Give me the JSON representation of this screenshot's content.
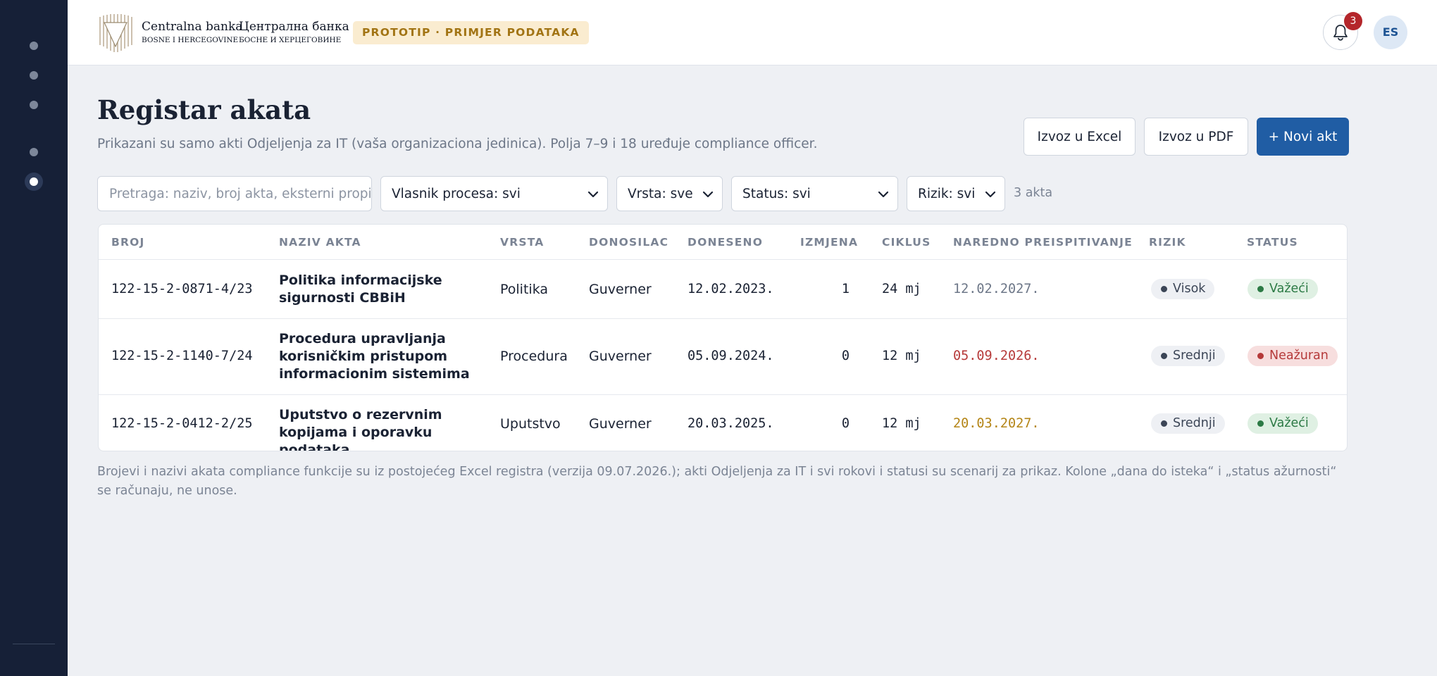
{
  "header": {
    "logo_latin_name": "Centralna banka",
    "logo_latin_sub": "BOSNE I HERCEGOVINE",
    "logo_cyrillic_name": "Централна банка",
    "logo_cyrillic_sub": "БОСНЕ И ХЕРЦЕГОВИНЕ",
    "prototype_badge": "PROTOTIP · PRIMJER PODATAKA",
    "notification_count": "3",
    "user_initials": "ES"
  },
  "page": {
    "title": "Registar akata",
    "subtitle": "Prikazani su samo akti Odjeljenja za IT (vaša organizaciona jedinica). Polja 7–9 i 18 uređuje compliance officer."
  },
  "actions": {
    "export_excel": "Izvoz u Excel",
    "export_pdf": "Izvoz u PDF",
    "new_act": "+ Novi akt"
  },
  "filters": {
    "search_placeholder": "Pretraga: naziv, broj akta, eksterni propis",
    "process_owner": "Vlasnik procesa: svi",
    "type": "Vrsta: sve",
    "status": "Status: svi",
    "risk": "Rizik: svi",
    "result_count": "3 akta"
  },
  "table": {
    "columns": [
      "BROJ",
      "NAZIV AKTA",
      "VRSTA",
      "DONOSILAC",
      "DONESENO",
      "IZMJENA",
      "CIKLUS",
      "NAREDNO PREISPITIVANJE",
      "RIZIK",
      "STATUS"
    ],
    "rows": [
      {
        "number": "122-15-2-0871-4/23",
        "title": "Politika informacijske sigurnosti CBBiH",
        "type": "Politika",
        "issuer": "Guverner",
        "adopted": "12.02.2023.",
        "amendments": "1",
        "cycle": "24 mj",
        "next_review": "12.02.2027.",
        "risk": "Visok",
        "status": "Važeći"
      },
      {
        "number": "122-15-2-1140-7/24",
        "title": "Procedura upravljanja korisničkim pristupom informacionim sistemima",
        "type": "Procedura",
        "issuer": "Guverner",
        "adopted": "05.09.2024.",
        "amendments": "0",
        "cycle": "12 mj",
        "next_review": "05.09.2026.",
        "risk": "Srednji",
        "status": "Neažuran"
      },
      {
        "number": "122-15-2-0412-2/25",
        "title": "Uputstvo o rezervnim kopijama i oporavku podataka",
        "type": "Uputstvo",
        "issuer": "Guverner",
        "adopted": "20.03.2025.",
        "amendments": "0",
        "cycle": "12 mj",
        "next_review": "20.03.2027.",
        "risk": "Srednji",
        "status": "Važeći"
      }
    ]
  },
  "footnote": "Brojevi i nazivi akata compliance funkcije su iz postojećeg Excel registra (verzija 09.07.2026.); akti Odjeljenja za IT i svi rokovi i statusi su scenarij za prikaz. Kolone „dana do isteka“ i „status ažurnosti“ se računaju, ne unose.",
  "colors": {
    "sidebar": "#162037",
    "primary": "#205da4",
    "danger": "#b53a3a",
    "success": "#2c7a45",
    "warning": "#b48516"
  },
  "icons": {
    "bell": "bell-icon",
    "chevron": "chevron-down-icon",
    "logo": "cbbih-logo-icon"
  }
}
